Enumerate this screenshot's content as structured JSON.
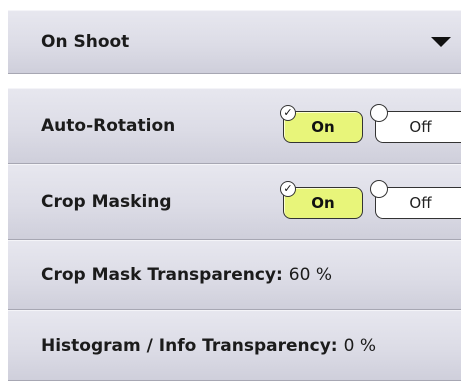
{
  "menu": {
    "header": {
      "label": "On Shoot",
      "arrow_icon": "triangle-down-icon"
    },
    "rows": [
      {
        "label": "Auto-Rotation",
        "toggle": {
          "on_label": "On",
          "off_label": "Off",
          "selected": "On"
        }
      },
      {
        "label": "Crop Masking",
        "toggle": {
          "on_label": "On",
          "off_label": "Off",
          "selected": "On"
        }
      },
      {
        "label": "Crop Mask Transparency:",
        "value": "60 %"
      },
      {
        "label": "Histogram / Info Transparency:",
        "value": "0 %"
      }
    ]
  },
  "colors": {
    "row_background": "#dcdce6",
    "toggle_on_background": "#e8f57a",
    "toggle_off_background": "#ffffff",
    "text": "#1b1b1b"
  }
}
